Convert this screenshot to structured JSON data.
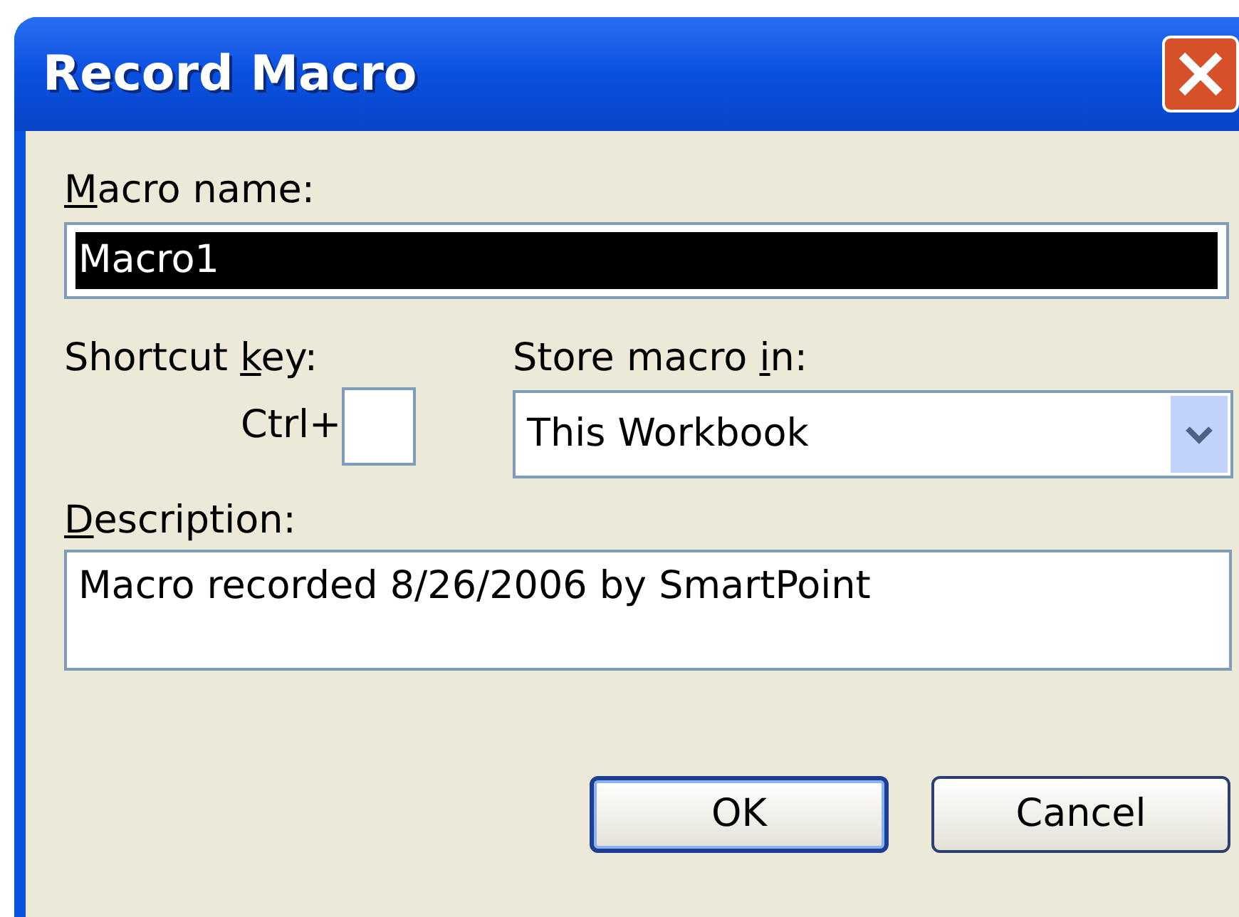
{
  "window": {
    "title": "Record Macro"
  },
  "macro_name": {
    "label": {
      "key": "M",
      "after": "acro name:"
    },
    "value": "Macro1",
    "text_selected": true
  },
  "shortcut_key": {
    "label": {
      "before": "Shortcut ",
      "key": "k",
      "after": "ey:"
    },
    "prefix": "Ctrl+"
  },
  "store_macro_in": {
    "label": {
      "before": "Store macro ",
      "key": "i",
      "after": "n:"
    },
    "value": "This Workbook"
  },
  "description": {
    "label": {
      "key": "D",
      "after": "escription:"
    },
    "value": "Macro recorded 8/26/2006 by SmartPoint"
  },
  "buttons": [
    {
      "label": "OK",
      "default": true
    },
    {
      "label": "Cancel",
      "default": false
    }
  ]
}
